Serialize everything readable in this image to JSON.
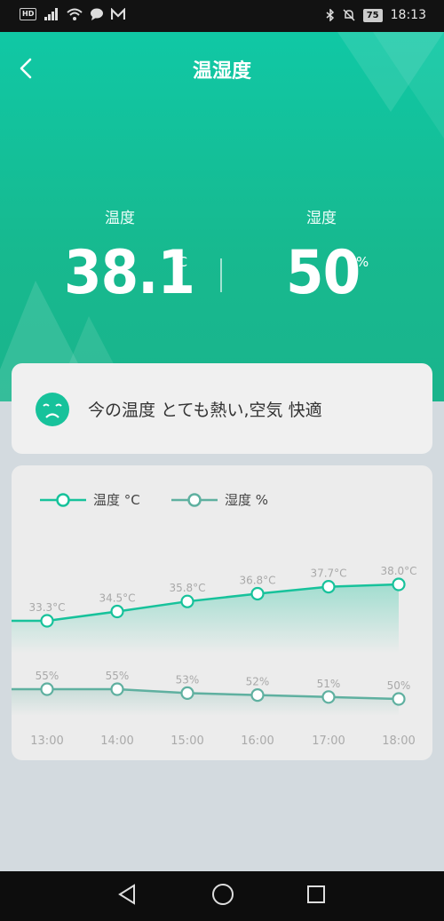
{
  "status_bar": {
    "hd": "HD",
    "battery": "75",
    "time": "18:13"
  },
  "header": {
    "title": "温湿度"
  },
  "temperature": {
    "label": "温度",
    "value": "38.1",
    "unit": "°C"
  },
  "humidity": {
    "label": "湿度",
    "value": "50",
    "unit": "%"
  },
  "status": {
    "text": "今の温度 とても熱い,空気 快適"
  },
  "legend": {
    "temp": "温度 °C",
    "hum": "湿度 %"
  },
  "colors": {
    "accent": "#17c29b",
    "accent_dark": "#1ab48c",
    "humidity_line": "#5fb0a0",
    "card_bg": "#ececec",
    "page_bg": "#d3dadf"
  },
  "chart_data": {
    "type": "line",
    "categories": [
      "13:00",
      "14:00",
      "15:00",
      "16:00",
      "17:00",
      "18:00"
    ],
    "series": [
      {
        "name": "温度 °C",
        "values": [
          33.3,
          34.5,
          35.8,
          36.8,
          37.7,
          38.0
        ],
        "labels": [
          "33.3°C",
          "34.5°C",
          "35.8°C",
          "36.8°C",
          "37.7°C",
          "38.0°C"
        ]
      },
      {
        "name": "湿度 %",
        "values": [
          55,
          55,
          53,
          52,
          51,
          50
        ],
        "labels": [
          "55%",
          "55%",
          "53%",
          "52%",
          "51%",
          "50%"
        ]
      }
    ],
    "grid": false,
    "legend_position": "top-left"
  }
}
